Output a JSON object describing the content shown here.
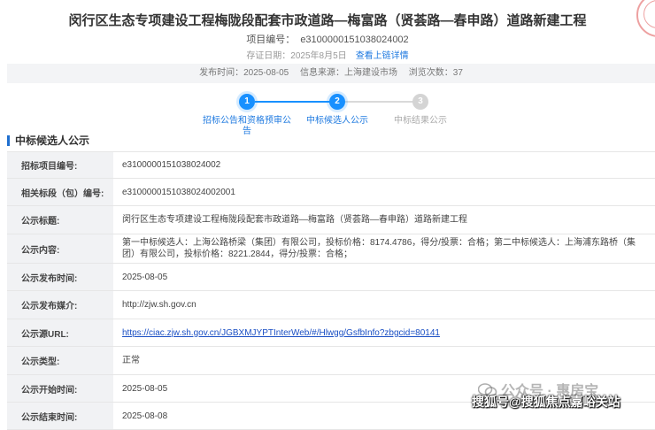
{
  "header": {
    "title": "闵行区生态专项建设工程梅陇段配套市政道路—梅富路（贤荟路—春申路）道路新建工程",
    "project_no_label": "项目编号：",
    "project_no": "e3100000151038024002",
    "store_date": "存证日期：2025年8月5日",
    "chain_link": "查看上链详情",
    "publish_time": "发布时间：2025-08-05",
    "source": "信息来源：上海建设市场",
    "views": "浏览次数：37"
  },
  "steps": [
    {
      "num": "1",
      "label": "招标公告和资格预审公",
      "label2": "告",
      "state": "on"
    },
    {
      "num": "2",
      "label": "中标候选人公示",
      "label2": "",
      "state": "on"
    },
    {
      "num": "3",
      "label": "中标结果公示",
      "label2": "",
      "state": "off"
    }
  ],
  "section_title": "中标候选人公示",
  "table": {
    "rows": [
      {
        "label": "招标项目编号:",
        "value": "e3100000151038024002"
      },
      {
        "label": "相关标段（包）编号:",
        "value": "e3100000151038024002001"
      },
      {
        "label": "公示标题:",
        "value": "闵行区生态专项建设工程梅陇段配套市政道路—梅富路（贤荟路—春申路）道路新建工程"
      },
      {
        "label": "公示内容:",
        "value": "第一中标候选人：上海公路桥梁（集团）有限公司，投标价格：8174.4786，得分/投票：合格；第二中标候选人：上海浦东路桥（集团）有限公司，投标价格：8221.2844，得分/投票：合格；"
      },
      {
        "label": "公示发布时间:",
        "value": "2025-08-05"
      },
      {
        "label": "公示发布媒介:",
        "value": "http://zjw.sh.gov.cn"
      },
      {
        "label": "公示源URL:",
        "value": "https://ciac.zjw.sh.gov.cn/JGBXMJYPTInterWeb/#/Hlwgg/GsfbInfo?zbgcid=80141"
      },
      {
        "label": "公示类型:",
        "value": "正常"
      },
      {
        "label": "公示开始时间:",
        "value": "2025-08-05"
      },
      {
        "label": "公示结束时间:",
        "value": "2025-08-08"
      }
    ]
  },
  "watermark": {
    "line1": "公众号 · 惠房宝",
    "line2": "搜狐号@搜狐焦点嘉峪关站"
  },
  "colors": {
    "accent": "#1890ff",
    "link": "#1a4fc4",
    "label_bg": "#f1f2f4"
  }
}
